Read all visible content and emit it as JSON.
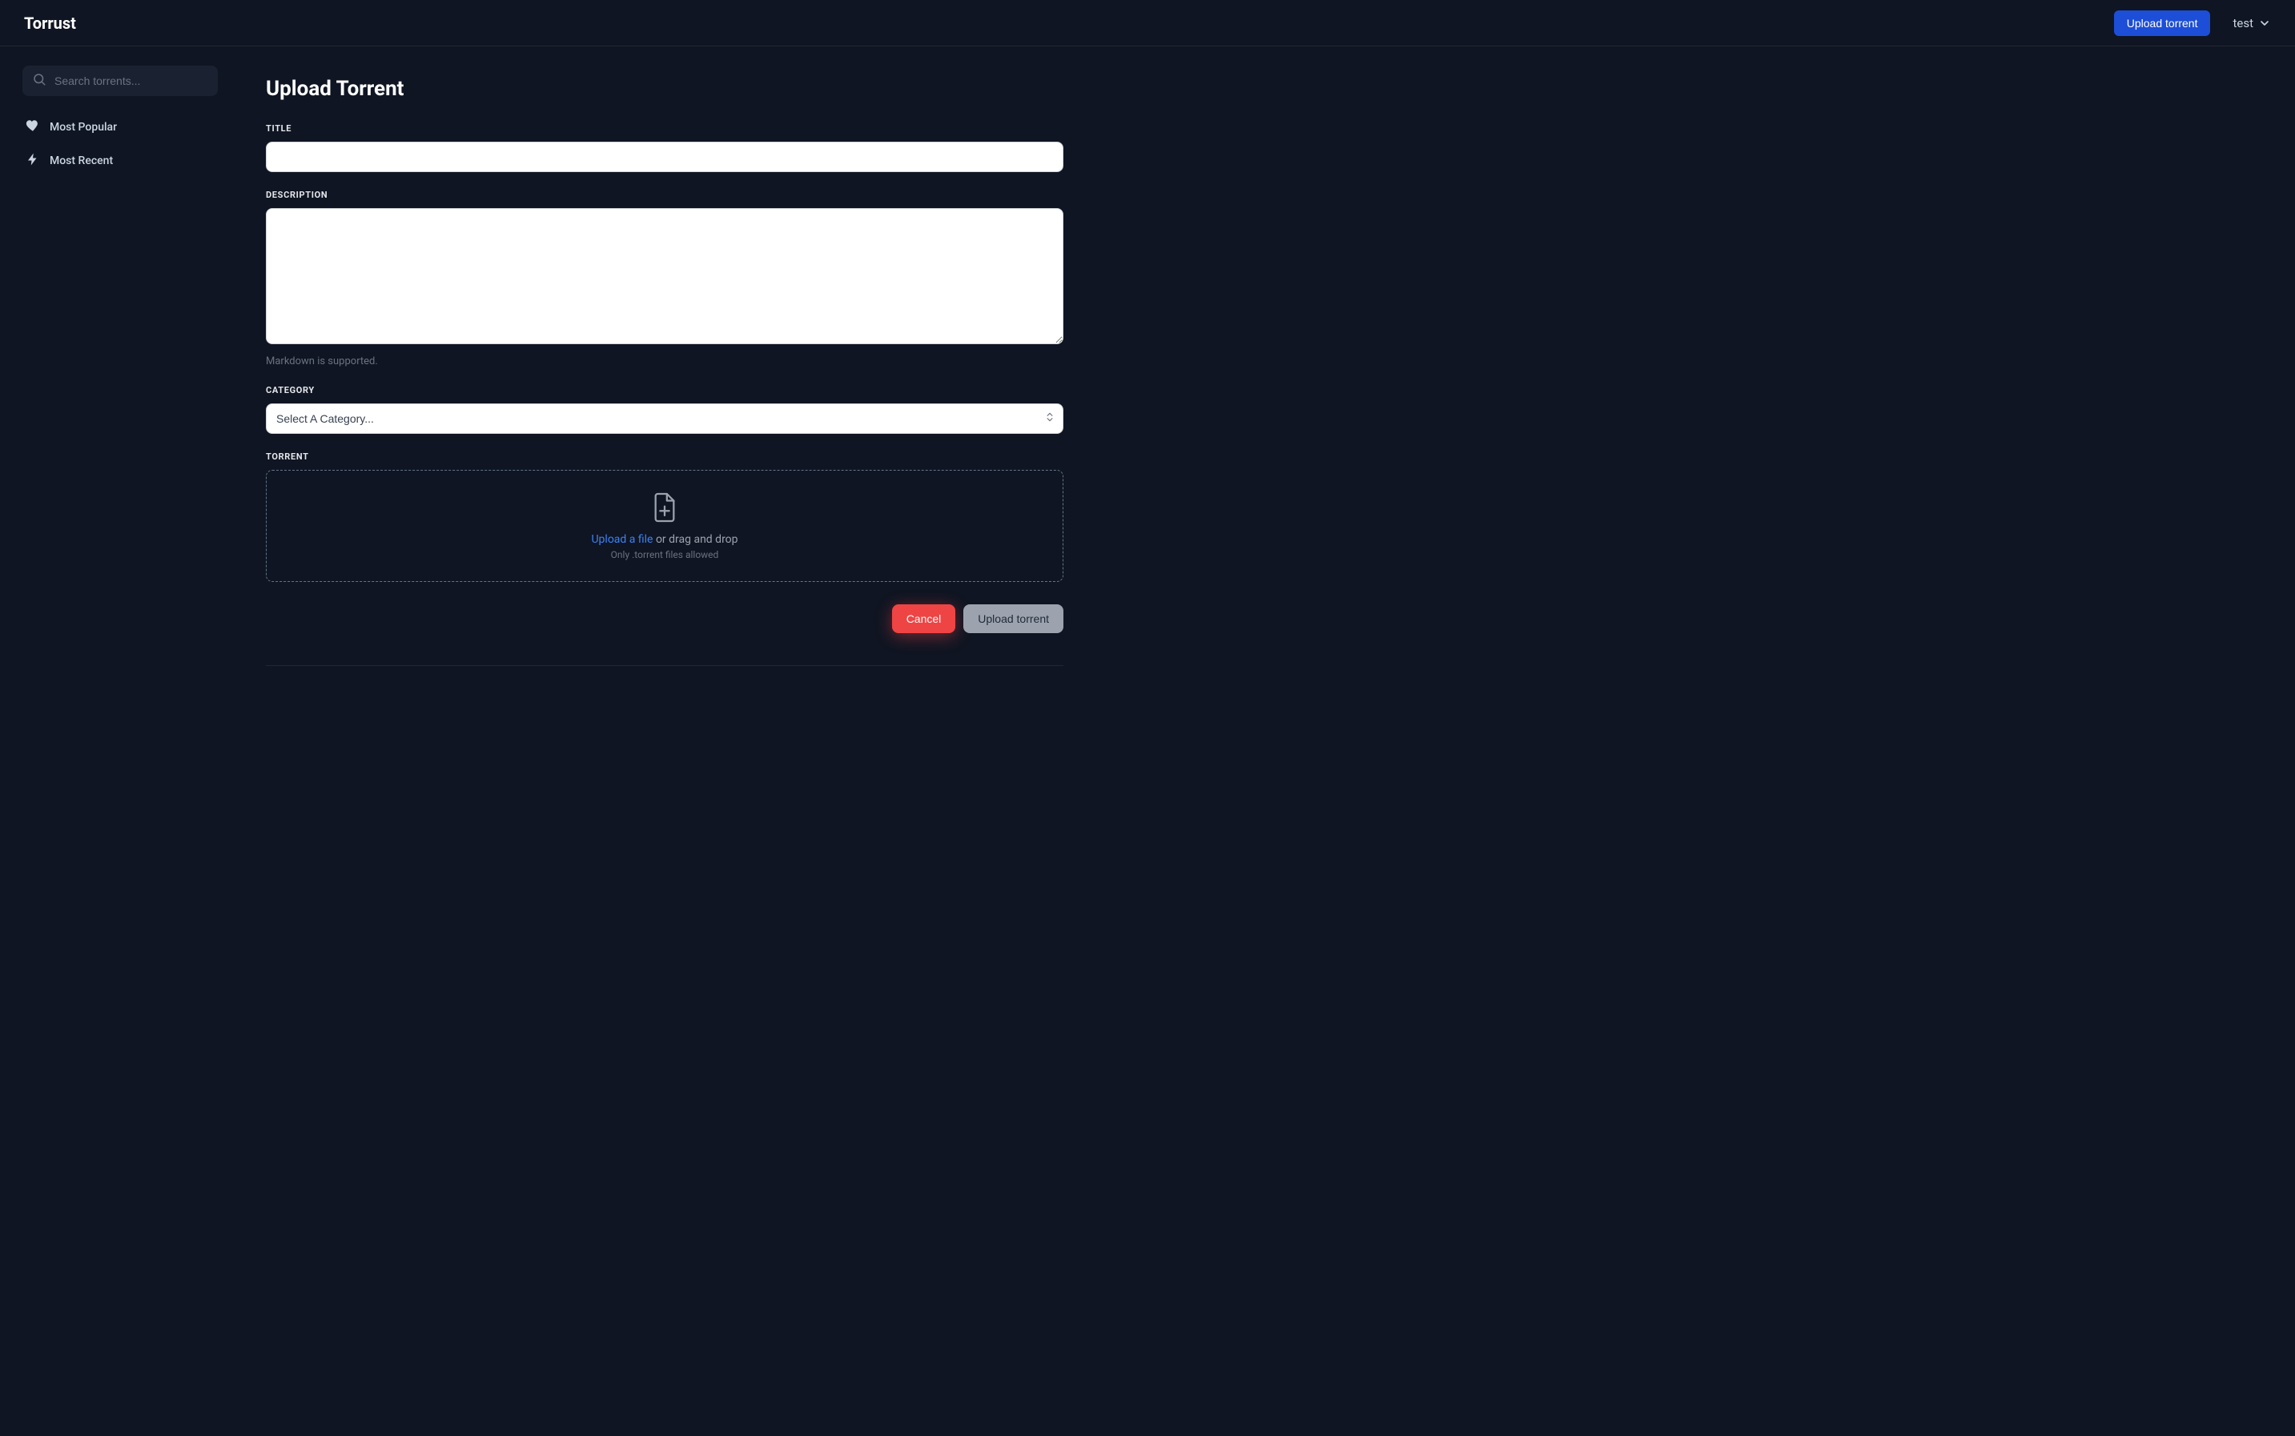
{
  "header": {
    "brand": "Torrust",
    "upload_button": "Upload torrent",
    "user": "test"
  },
  "sidebar": {
    "search_placeholder": "Search torrents...",
    "items": [
      {
        "label": "Most Popular"
      },
      {
        "label": "Most Recent"
      }
    ]
  },
  "page": {
    "title": "Upload Torrent",
    "title_label": "TITLE",
    "title_value": "",
    "description_label": "DESCRIPTION",
    "description_value": "",
    "markdown_hint": "Markdown is supported.",
    "category_label": "CATEGORY",
    "category_placeholder": "Select A Category...",
    "torrent_label": "TORRENT",
    "dropzone": {
      "link_text": "Upload a file",
      "suffix_text": " or drag and drop",
      "subtext": "Only .torrent files allowed"
    },
    "actions": {
      "cancel": "Cancel",
      "submit": "Upload torrent"
    }
  }
}
